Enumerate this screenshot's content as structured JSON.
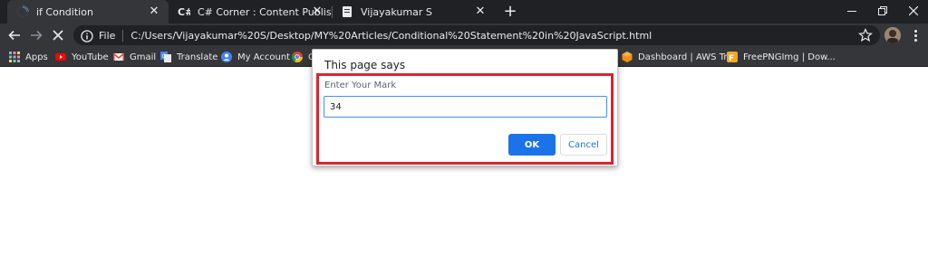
{
  "tabs": [
    {
      "title": "if Condition",
      "icon": "loading-spinner-icon"
    },
    {
      "title": "C# Corner : Content Publisher",
      "icon": "csharp-corner-icon"
    },
    {
      "title": "Vijayakumar S",
      "icon": "page-icon"
    }
  ],
  "tab_close_glyph": "✕",
  "new_tab_glyph": "+",
  "address_bar": {
    "scheme_label": "File",
    "url": "C:/Users/Vijayakumar%20S/Desktop/MY%20Articles/Conditional%20Statement%20in%20JavaScript.html"
  },
  "bookmarks": [
    {
      "label": "Apps",
      "icon": "apps-grid-icon"
    },
    {
      "label": "YouTube",
      "icon": "youtube-icon"
    },
    {
      "label": "Gmail",
      "icon": "gmail-icon"
    },
    {
      "label": "Translate",
      "icon": "translate-icon"
    },
    {
      "label": "My Account",
      "icon": "account-icon"
    },
    {
      "label": "C",
      "icon": "chrome-icon"
    },
    {
      "label": "Dashboard | AWS Tr...",
      "icon": "aws-icon"
    },
    {
      "label": "FreePNGImg | Dow...",
      "icon": "freepngimg-icon"
    }
  ],
  "dialog": {
    "title": "This page says",
    "message": "Enter Your Mark",
    "input_value": "34",
    "ok_label": "OK",
    "cancel_label": "Cancel"
  },
  "colors": {
    "tab_strip": "#202124",
    "toolbar": "#35363a",
    "highlight_border": "#d7262e",
    "primary_button": "#1a73e8"
  }
}
